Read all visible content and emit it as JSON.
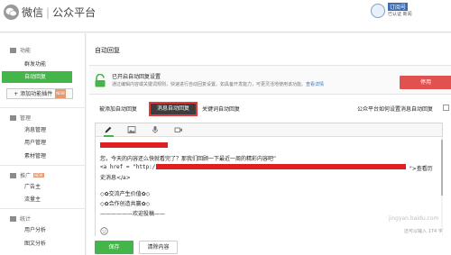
{
  "header": {
    "brand_name": "微信",
    "product_name": "公众平台",
    "user_name": "订阅号",
    "user_sub": "已认证 新闻"
  },
  "sidebar": {
    "groups": [
      {
        "label": "功能",
        "items": [
          {
            "label": "群发功能"
          },
          {
            "label": "自动回复",
            "active": true
          }
        ]
      },
      {
        "label": "管理",
        "items": [
          {
            "label": "消息管理"
          },
          {
            "label": "用户管理"
          },
          {
            "label": "素材管理"
          }
        ]
      },
      {
        "label": "推广",
        "badge": "NEW",
        "items": [
          {
            "label": "广告主"
          },
          {
            "label": "流量主"
          }
        ]
      },
      {
        "label": "统计",
        "items": [
          {
            "label": "用户分析"
          },
          {
            "label": "图文分析"
          }
        ]
      }
    ],
    "add_plugin_label": "+ 添加功能插件",
    "add_plugin_badge": "NEW"
  },
  "main": {
    "title": "自动回复",
    "status": {
      "title": "已开启自动回复设置",
      "desc": "通过编辑内容或关键词规则，快速进行自动回复设置。如具备开发能力，可更灵活地使用该功能。",
      "link": "查看详情",
      "stop_label": "停用"
    },
    "tabs": [
      {
        "label": "被添加自动回复"
      },
      {
        "label": "消息自动回复",
        "active": true
      },
      {
        "label": "关键词自动回复"
      }
    ],
    "help_link": "公众平台如何设置消息自动回复",
    "editor": {
      "tools": [
        "pen-icon",
        "image-icon",
        "voice-icon",
        "video-icon"
      ],
      "lines": [
        "您，今天的内容还么快就看完了？那我们回顾一下最近一周的精彩内容吧”",
        "<a href = \"http://",
        "\">查看历",
        "史消息</a>",
        "◇✿交流产生价值✿◇",
        "◇✿合作创造共赢✿◇",
        "——————欢迎投稿——"
      ],
      "char_count": "还可以输入 174 字"
    },
    "save_label": "保存",
    "clear_label": "清除内容"
  },
  "watermark": "jingyan.baidu.com",
  "colors": {
    "accent_green": "#44b549",
    "stop_red": "#e0514f",
    "redaction_red": "#e02020"
  }
}
